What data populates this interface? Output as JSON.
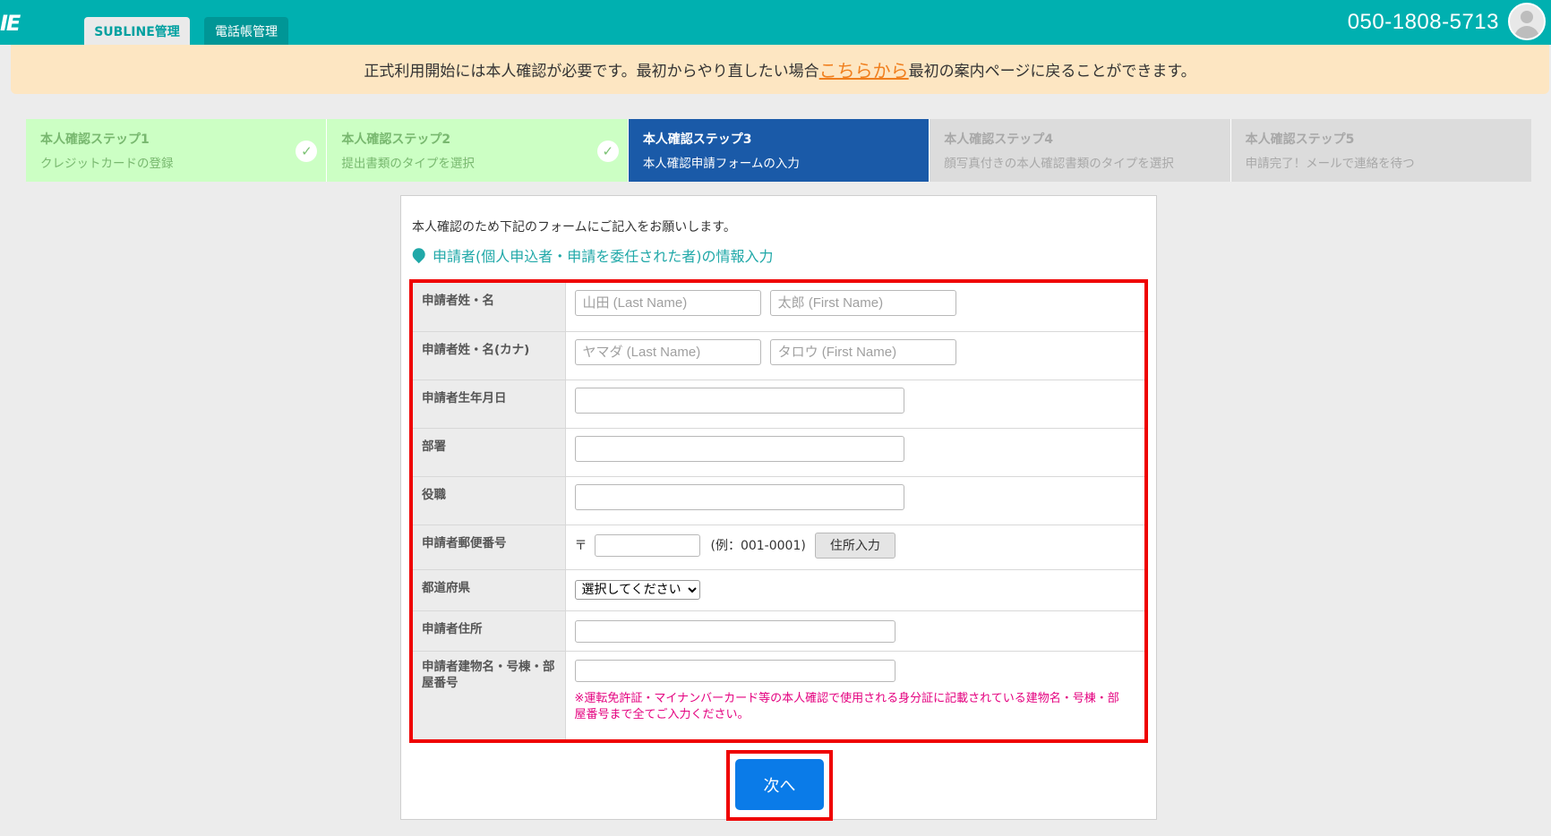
{
  "header": {
    "logo": "IE",
    "tabs": [
      {
        "label": "SUBLINE管理",
        "active": true
      },
      {
        "label": "電話帳管理",
        "active": false
      }
    ],
    "phone": "050-1808-5713"
  },
  "notice": {
    "before": "正式利用開始には本人確認が必要です。最初からやり直したい場合",
    "link": "こちらから",
    "after": "最初の案内ページに戻ることができます。"
  },
  "steps": [
    {
      "title": "本人確認ステップ1",
      "sub": "クレジットカードの登録",
      "state": "done"
    },
    {
      "title": "本人確認ステップ2",
      "sub": "提出書類のタイプを選択",
      "state": "done"
    },
    {
      "title": "本人確認ステップ3",
      "sub": "本人確認申請フォームの入力",
      "state": "active"
    },
    {
      "title": "本人確認ステップ4",
      "sub": "顔写真付きの本人確認書類のタイプを選択",
      "state": "pending"
    },
    {
      "title": "本人確認ステップ5",
      "sub": "申請完了！メールで連絡を待つ",
      "state": "pending"
    }
  ],
  "form": {
    "intro": "本人確認のため下記のフォームにご記入をお願いします。",
    "section": "申請者(個人申込者・申請を委任された者)の情報入力",
    "labels": {
      "name": "申請者姓・名",
      "kana": "申請者姓・名(カナ)",
      "birthday": "申請者生年月日",
      "department": "部署",
      "position": "役職",
      "zip": "申請者郵便番号",
      "prefecture": "都道府県",
      "address": "申請者住所",
      "building": "申請者建物名・号棟・部屋番号"
    },
    "placeholders": {
      "last_name": "山田 (Last Name)",
      "first_name": "太郎 (First Name)",
      "last_kana": "ヤマダ (Last Name)",
      "first_kana": "タロウ (First Name)"
    },
    "zip_mark": "〒",
    "zip_example": "(例：001-0001)",
    "address_button": "住所入力",
    "prefecture_selected": "選択してください",
    "building_note": "※運転免許証・マイナンバーカード等の本人確認で使用される身分証に記載されている建物名・号棟・部屋番号まで全てご入力ください。",
    "next_button": "次へ"
  },
  "colors": {
    "header": "#00b0b0",
    "active_step": "#1a5aa8",
    "done_step": "#ccffc4",
    "highlight": "#ef0000",
    "next_button": "#0a7be8"
  }
}
